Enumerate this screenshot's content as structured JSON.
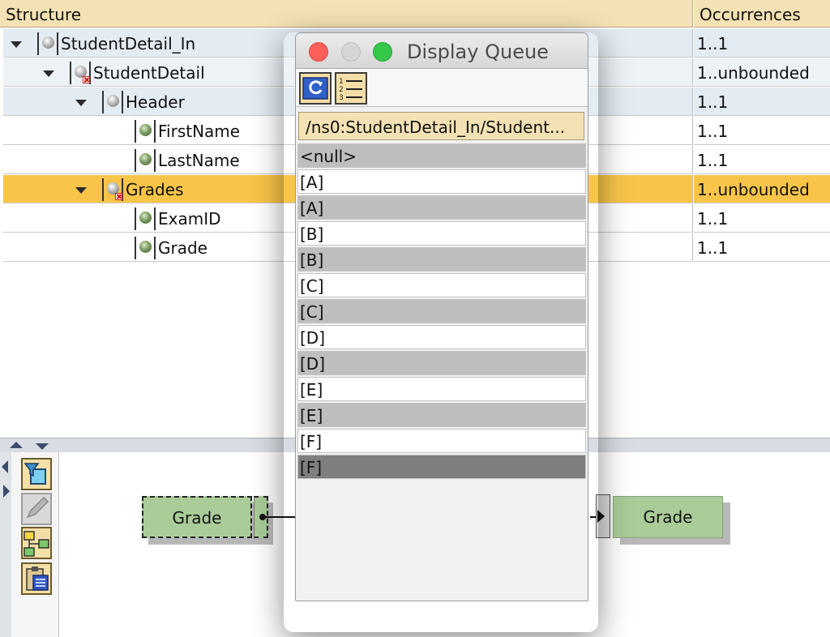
{
  "tree": {
    "header": {
      "structure": "Structure",
      "occurrences": "Occurrences"
    },
    "rows": [
      {
        "label": "StudentDetail_In",
        "occ": "1..1",
        "icon": "grey-ball-icon"
      },
      {
        "label": "StudentDetail",
        "occ": "1..unbounded",
        "icon": "grey-ball-error-icon"
      },
      {
        "label": "Header",
        "occ": "1..1",
        "icon": "grey-ball-icon"
      },
      {
        "label": "FirstName",
        "occ": "1..1",
        "icon": "green-ball-icon"
      },
      {
        "label": "LastName",
        "occ": "1..1",
        "icon": "green-ball-icon"
      },
      {
        "label": "Grades",
        "occ": "1..unbounded",
        "icon": "grey-ball-error-icon"
      },
      {
        "label": "ExamID",
        "occ": "1..1",
        "icon": "green-ball-icon"
      },
      {
        "label": "Grade",
        "occ": "1..1",
        "icon": "green-ball-icon"
      }
    ]
  },
  "dialog": {
    "title": "Display Queue",
    "path": "/ns0:StudentDetail_In/Student...",
    "items": [
      "<null>",
      "[A]",
      "[A]",
      "[B]",
      "[B]",
      "[C]",
      "[C]",
      "[D]",
      "[D]",
      "[E]",
      "[E]",
      "[F]",
      "[F]"
    ]
  },
  "mapping": {
    "source": "Grade",
    "target": "Grade"
  },
  "colors": {
    "selected_row": "#f9c548",
    "header": "#f4e2b4",
    "node_box": "#a9cc98"
  }
}
